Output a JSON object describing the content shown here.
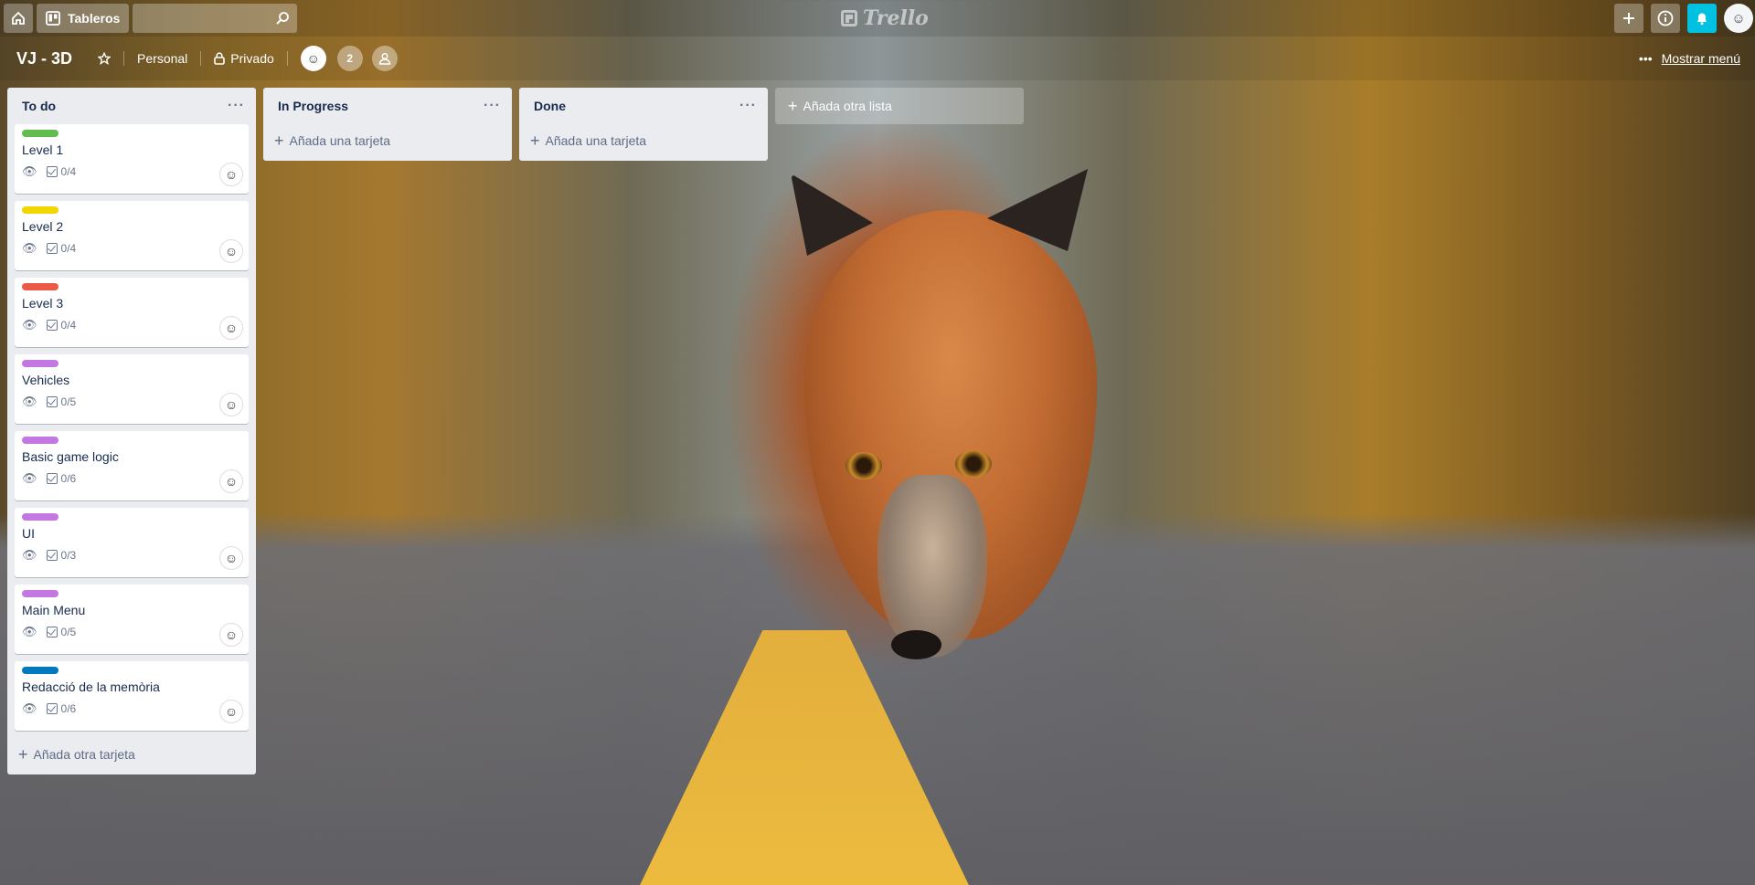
{
  "topbar": {
    "home_icon": "home-icon",
    "boards_label": "Tableros",
    "search": {
      "value": "",
      "placeholder": ""
    },
    "logo": "Trello",
    "add_icon": "plus-icon",
    "info_icon": "info-icon",
    "bell_icon": "bell-icon"
  },
  "board": {
    "title": "VJ - 3D",
    "team": "Personal",
    "visibility": "Privado",
    "member_count": "2",
    "show_menu": "Mostrar menú"
  },
  "lists": [
    {
      "title": "To do",
      "cards": [
        {
          "label_color": "#61bd4f",
          "title": "Level 1",
          "checklist": "0/4"
        },
        {
          "label_color": "#f2d600",
          "title": "Level 2",
          "checklist": "0/4"
        },
        {
          "label_color": "#eb5a46",
          "title": "Level 3",
          "checklist": "0/4"
        },
        {
          "label_color": "#c377e0",
          "title": "Vehicles",
          "checklist": "0/5"
        },
        {
          "label_color": "#c377e0",
          "title": "Basic game logic",
          "checklist": "0/6"
        },
        {
          "label_color": "#c377e0",
          "title": "UI",
          "checklist": "0/3"
        },
        {
          "label_color": "#c377e0",
          "title": "Main Menu",
          "checklist": "0/5"
        },
        {
          "label_color": "#0079bf",
          "title": "Redacció de la memòria",
          "checklist": "0/6"
        }
      ],
      "add_label": "Añada otra tarjeta"
    },
    {
      "title": "In Progress",
      "cards": [],
      "add_label": "Añada una tarjeta"
    },
    {
      "title": "Done",
      "cards": [],
      "add_label": "Añada una tarjeta"
    }
  ],
  "add_list_label": "Añada otra lista"
}
